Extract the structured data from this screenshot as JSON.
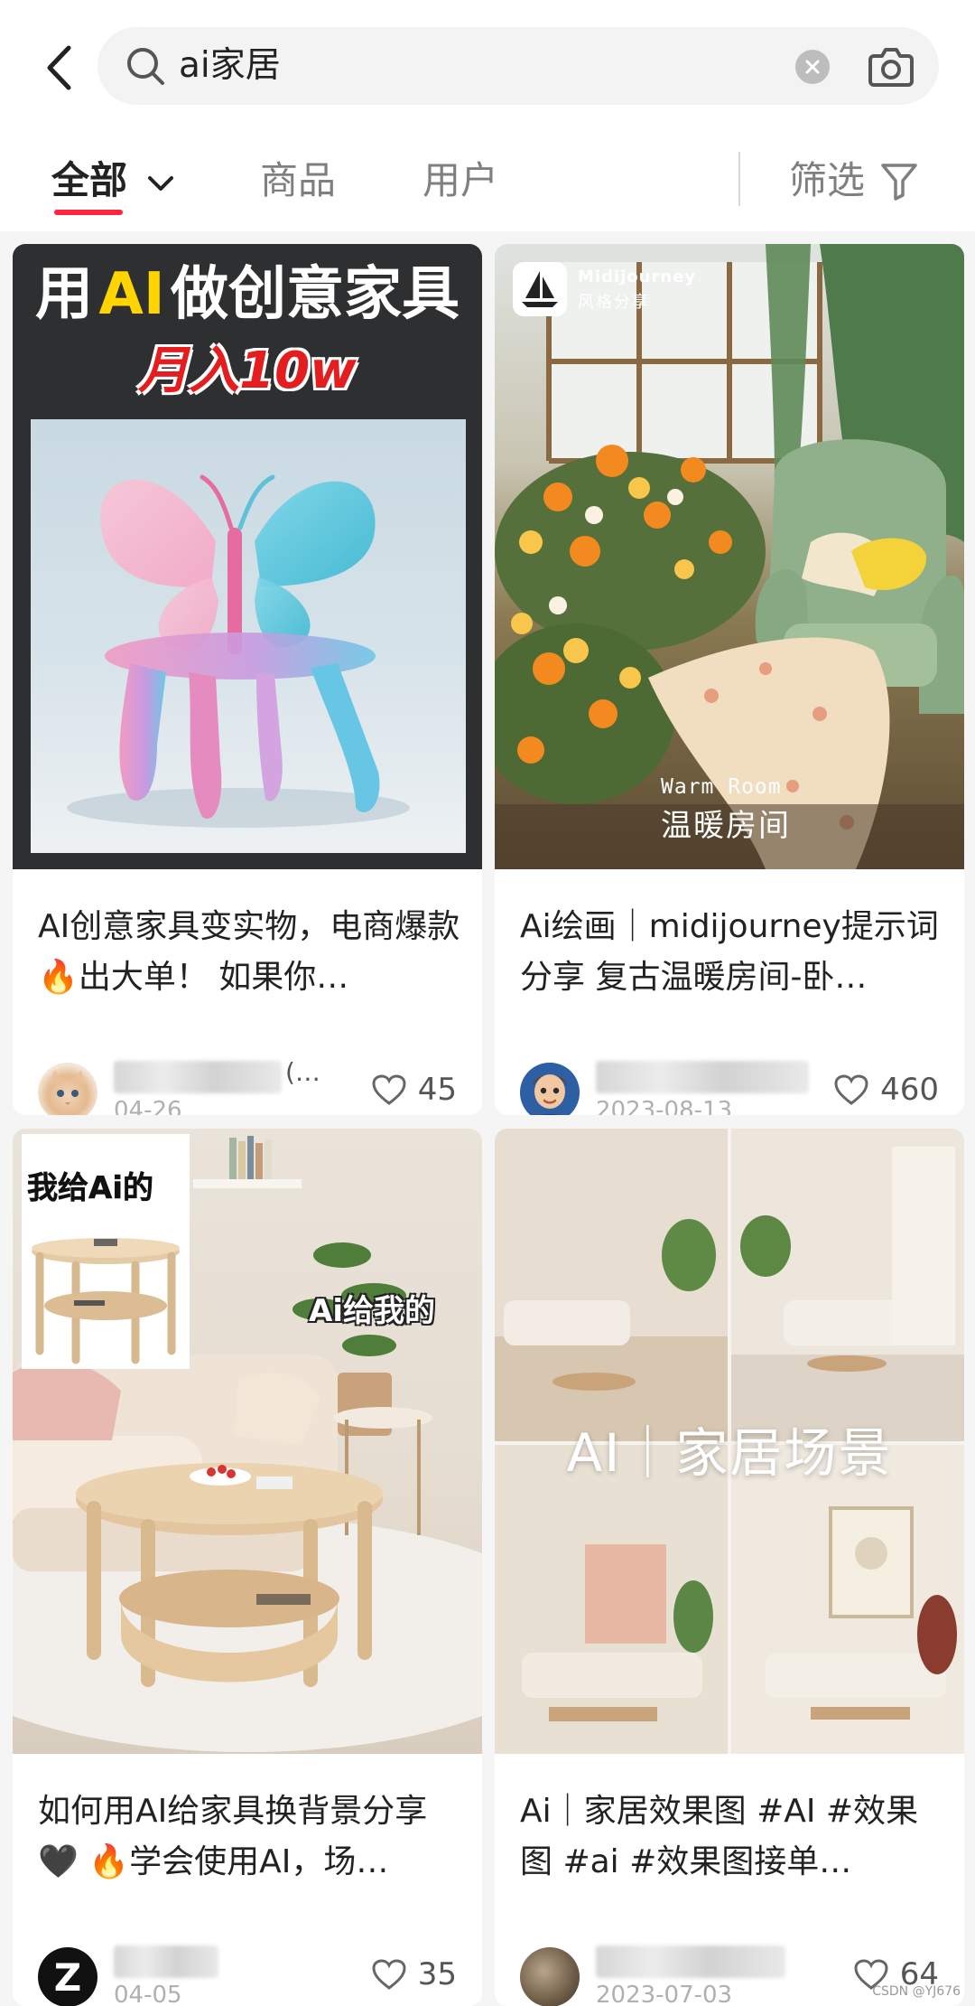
{
  "search": {
    "query": "ai家居"
  },
  "tabs": {
    "all": "全部",
    "goods": "商品",
    "users": "用户",
    "filter": "筛选"
  },
  "cards": [
    {
      "overlay_line1_a": "用",
      "overlay_line1_ai": "AI",
      "overlay_line1_b": "做创意家具",
      "overlay_line2": "月入10w",
      "title": "AI创意家具变实物，电商爆款 🔥出大单！ 如果你…",
      "name_suffix": "(…",
      "date": "04-26",
      "likes": "45"
    },
    {
      "badge_title": "Midijourney",
      "badge_sub": "风格分享",
      "overlay_en": "Warm Room",
      "overlay_cn": "温暖房间",
      "title": "Ai绘画｜midijourney提示词分享 复古温暖房间-卧…",
      "date": "2023-08-13",
      "likes": "460"
    },
    {
      "overlay_mine": "我给Ai的",
      "overlay_ai": "Ai给我的",
      "title": "如何用AI给家具换背景分享🖤 🔥学会使用AI，场…",
      "avatar_letter": "Z",
      "date": "04-05",
      "likes": "35"
    },
    {
      "overlay": "AI｜家居场景",
      "title": "Ai｜家居效果图 #AI  #效果图  #ai  #效果图接单…",
      "date": "2023-07-03",
      "likes": "64"
    }
  ],
  "watermark": "CSDN @YJ676"
}
